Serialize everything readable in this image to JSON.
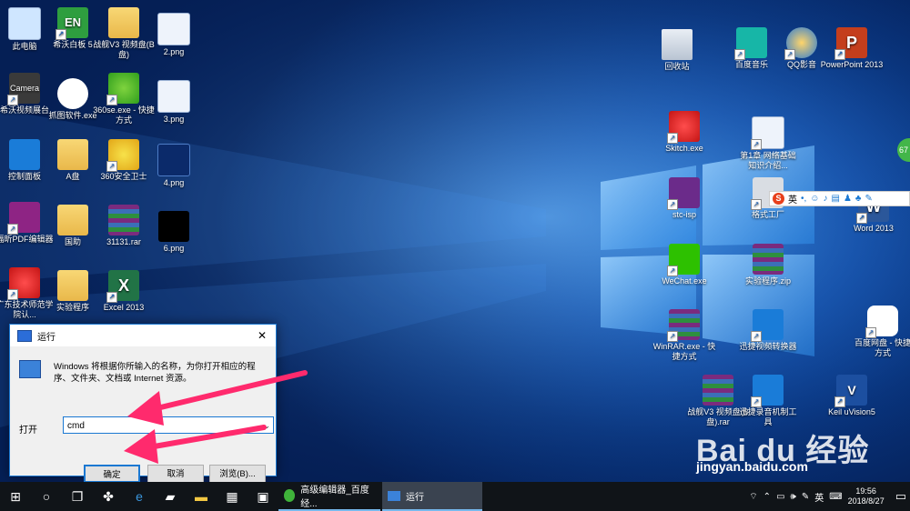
{
  "desktop_icons": [
    {
      "label": "此电脑",
      "icon": "computer-icon"
    },
    {
      "label": "希沃白板 5",
      "icon": "en-app-icon"
    },
    {
      "label": "战舰V3 视频盘(B盘)",
      "icon": "folder-icon"
    },
    {
      "label": "2.png",
      "icon": "image-file-icon"
    },
    {
      "label": "希沃视频展台",
      "icon": "camera-app-icon"
    },
    {
      "label": "抓图软件.exe",
      "icon": "camera-icon"
    },
    {
      "label": "360se.exe - 快捷方式",
      "icon": "browser-360-icon"
    },
    {
      "label": "3.png",
      "icon": "image-file-icon"
    },
    {
      "label": "控制面板",
      "icon": "control-panel-icon"
    },
    {
      "label": "A盘",
      "icon": "folder-icon"
    },
    {
      "label": "360安全卫士",
      "icon": "security-360-icon"
    },
    {
      "label": "4.png",
      "icon": "image-file-icon"
    },
    {
      "label": "福昕PDF编辑器",
      "icon": "pdf-editor-icon"
    },
    {
      "label": "国助",
      "icon": "folder-icon"
    },
    {
      "label": "31131.rar",
      "icon": "rar-icon"
    },
    {
      "label": "6.png",
      "icon": "image-file-icon"
    },
    {
      "label": "广东技术师范学院认...",
      "icon": "shield-app-icon"
    },
    {
      "label": "实验程序",
      "icon": "folder-icon"
    },
    {
      "label": "Excel 2013",
      "icon": "excel-icon"
    },
    {
      "label": "回收站",
      "icon": "recycle-bin-icon"
    },
    {
      "label": "百度音乐",
      "icon": "music-icon"
    },
    {
      "label": "QQ影音",
      "icon": "video-player-icon"
    },
    {
      "label": "PowerPoint 2013",
      "icon": "powerpoint-icon"
    },
    {
      "label": "Skitch.exe",
      "icon": "skitch-icon"
    },
    {
      "label": "第1章 网络基础知识介绍...",
      "icon": "ppt-file-icon"
    },
    {
      "label": "stc-isp",
      "icon": "stc-isp-icon"
    },
    {
      "label": "格式工厂",
      "icon": "format-factory-icon"
    },
    {
      "label": "Word 2013",
      "icon": "word-icon"
    },
    {
      "label": "WeChat.exe",
      "icon": "wechat-icon"
    },
    {
      "label": "实验程序.zip",
      "icon": "rar-icon"
    },
    {
      "label": "WinRAR.exe - 快捷方式",
      "icon": "rar-icon"
    },
    {
      "label": "迅捷视频转换器",
      "icon": "video-converter-icon"
    },
    {
      "label": "百度网盘 - 快捷方式",
      "icon": "cloud-drive-icon"
    },
    {
      "label": "战舰V3 视频盘(B盘).rar",
      "icon": "rar-icon"
    },
    {
      "label": "迅捷录音机制工具",
      "icon": "recorder-icon"
    },
    {
      "label": "Keil uVision5",
      "icon": "keil-icon"
    }
  ],
  "run_dialog": {
    "title": "运行",
    "description": "Windows 将根据你所输入的名称，为你打开相应的程序、文件夹、文档或 Internet 资源。",
    "open_label": "打开",
    "input_value": "cmd",
    "ok": "确定",
    "cancel": "取消",
    "browse": "浏览(B)..."
  },
  "ime_bar": {
    "mode": "英"
  },
  "watermark": {
    "brand": "Bai du 经验",
    "url": "jingyan.baidu.com"
  },
  "edge_badge": "67",
  "taskbar": {
    "apps": [
      {
        "label": "高级编辑器_百度经..."
      },
      {
        "label": "运行"
      }
    ],
    "ime": "英",
    "time": "19:56",
    "date": "2018/8/27"
  }
}
